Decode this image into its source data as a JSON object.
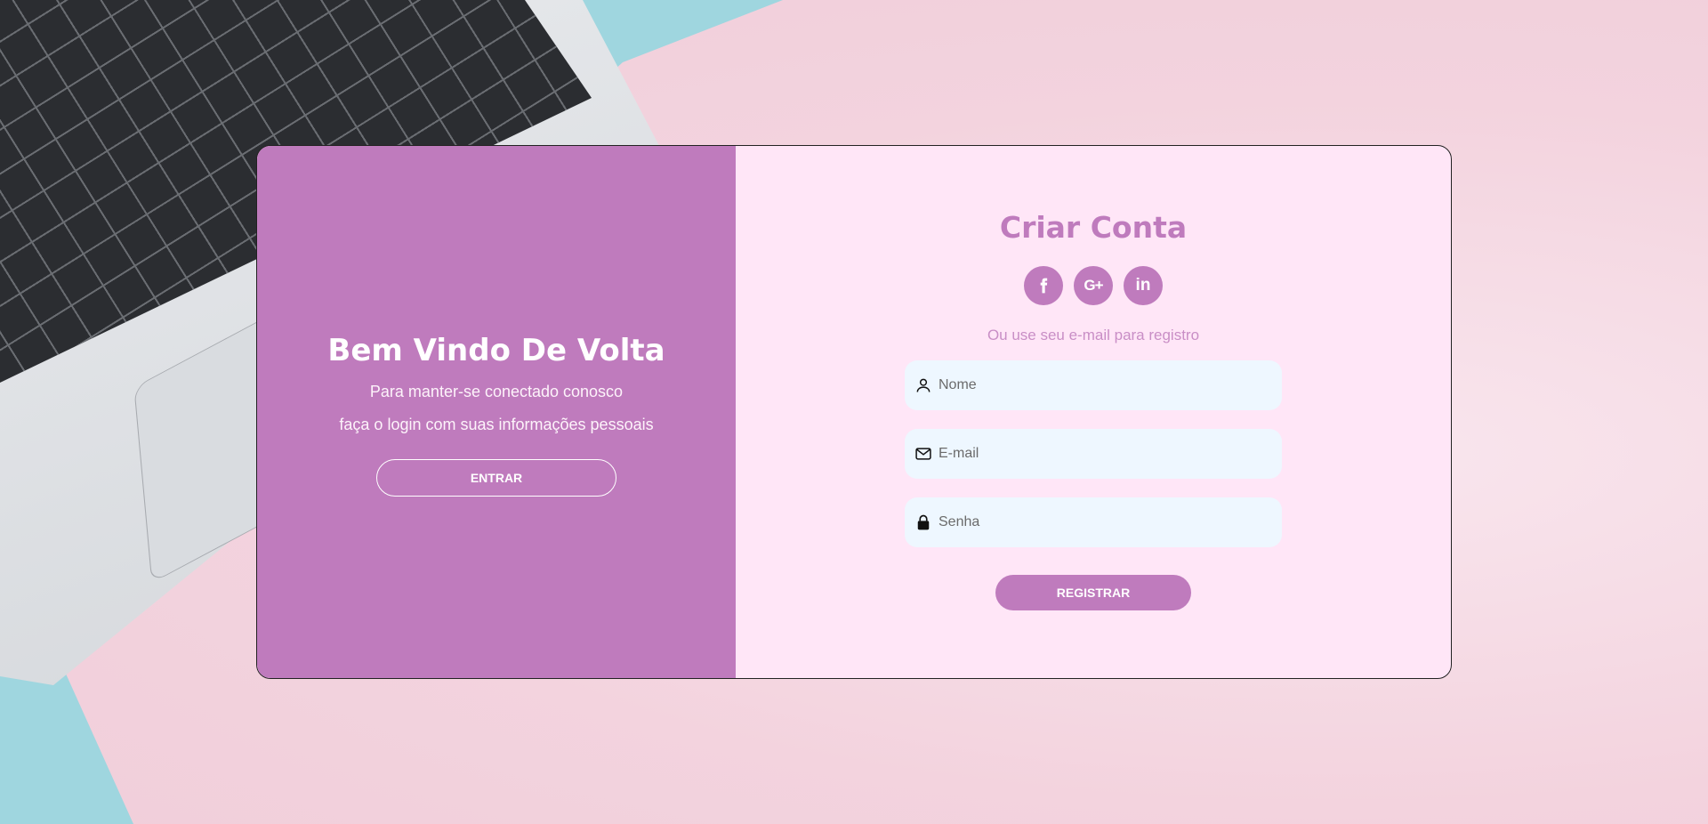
{
  "welcome": {
    "title": "Bem Vindo De Volta",
    "line1": "Para manter-se conectado conosco",
    "line2": "faça o login com suas informações pessoais",
    "signin_label": "ENTRAR"
  },
  "register": {
    "title": "Criar Conta",
    "socials": [
      {
        "icon": "facebook-icon",
        "glyph": "f"
      },
      {
        "icon": "google-plus-icon",
        "glyph": "G+"
      },
      {
        "icon": "linkedin-icon",
        "glyph": "in"
      }
    ],
    "hint": "Ou use seu e-mail para registro",
    "fields": {
      "name": {
        "placeholder": "Nome",
        "value": ""
      },
      "email": {
        "placeholder": "E-mail",
        "value": ""
      },
      "password": {
        "placeholder": "Senha",
        "value": ""
      }
    },
    "submit_label": "REGISTRAR"
  },
  "colors": {
    "accent": "#bf7bbd",
    "panel_bg": "#ffe6f7",
    "input_bg": "#eef7ff"
  }
}
